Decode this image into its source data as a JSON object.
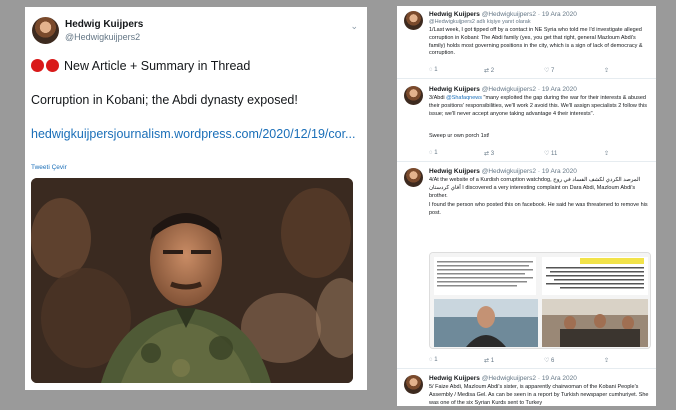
{
  "left_tweet": {
    "name": "Hedwig Kuijpers",
    "handle": "@Hedwigkuijpers2",
    "headline": "New Article + Summary in Thread",
    "title": "Corruption in Kobani; the Abdi dynasty exposed!",
    "link": "hedwigkuijpersjournalism.wordpress.com/2020/12/19/cor...",
    "translate": "Tweeti Çevir",
    "chevron": "⌄"
  },
  "thread": {
    "tweets": [
      {
        "name": "Hedwig Kuijpers",
        "meta": "@Hedwigkuijpers2 · 19 Ara 2020",
        "reply_to": "@Hedwigkuijpers2 adlı kişiye yanıt olarak",
        "body": "1/Last week, I got tipped off by a contact in NE Syria who told me I'd investigate alleged corruption in Kobani: The Abdi family (yes, you get that right, general Mazloum Abdi's family) holds most governing positions in the city, which is a sign of lack of democracy & corruption.",
        "actions": [
          "1",
          "2",
          "7"
        ]
      },
      {
        "name": "Hedwig Kuijpers",
        "meta": "@Hedwigkuijpers2 · 19 Ara 2020",
        "body_pre": "3/Abdi ",
        "mention": "@Shafaqnews",
        "body_post": " \"many exploited the gap during the war for their interests & abused their positions' responsibilities, we'll work 2 avoid this. We'll assign specialists 2 follow this issue; we'll never accept anyone taking advantage 4 their interests\".",
        "body_extra": "Sweep ur own porch 1st!",
        "actions": [
          "1",
          "3",
          "11"
        ]
      },
      {
        "name": "Hedwig Kuijpers",
        "meta": "@Hedwigkuijpers2 · 19 Ara 2020",
        "body": "4/At the website of a Kurdish corruption watchdog, المرصد الكردي لكشف الفساد في روج آفاي كردستان I discovered a very interesting complaint on Dara Abdi, Mazloum Abdi's brother.",
        "body_extra": "I found the person who posted this on facebook. He said he was threatened to remove his post.",
        "actions": [
          "1",
          "1",
          "6"
        ]
      },
      {
        "name": "Hedwig Kuijpers",
        "meta": "@Hedwigkuijpers2 · 19 Ara 2020",
        "body": "5/ Faize Abdi, Mazloum Abdi's sister, is apparently chairwoman of the Kobani People's Assembly / Medisa Gel. As can be seen in a report by Turkish newspaper cumhuriyet. She was one of the six Syrian Kurds sent to Turkey"
      }
    ]
  },
  "colors": {
    "background": "#9a9a9a",
    "link": "#1b6fb8",
    "red_dot": "#d91a1a"
  }
}
